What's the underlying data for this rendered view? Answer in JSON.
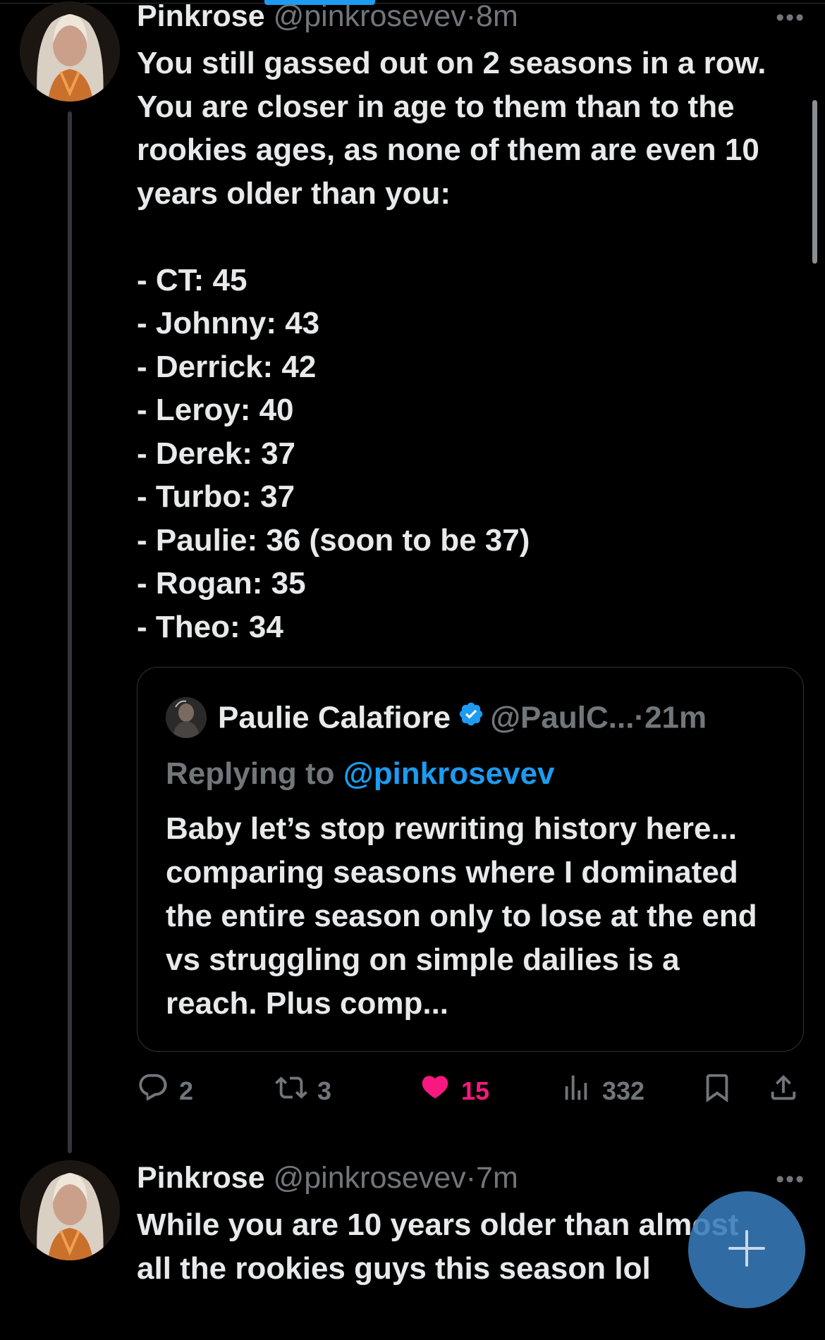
{
  "tweet1": {
    "display_name": "Pinkrose",
    "handle": "@pinkrosevev",
    "separator": "·",
    "time": "8m",
    "more": "•••",
    "paragraph": "You still gassed out on 2 seasons in a row. You are closer in age to them than to the rookies ages, as none of them are even 10 years older than you:",
    "list": [
      "- CT: 45",
      "- Johnny: 43",
      "- Derrick: 42",
      "- Leroy: 40",
      "- Derek: 37",
      "- Turbo: 37",
      "- Paulie: 36 (soon to be 37)",
      "- Rogan: 35",
      "- Theo: 34"
    ],
    "quote": {
      "display_name": "Paulie Calafiore",
      "handle": "@PaulC...",
      "separator": "·",
      "time": "21m",
      "replying_prefix": "Replying to",
      "replying_handle": "@pinkrosevev",
      "text": "Baby let’s stop rewriting history here... comparing seasons where I dominated the entire season only to lose at the end vs struggling on simple dailies is a reach. Plus comp..."
    },
    "actions": {
      "replies": "2",
      "reposts": "3",
      "likes": "15",
      "views": "332"
    }
  },
  "tweet2": {
    "display_name": "Pinkrose",
    "handle": "@pinkrosevev",
    "separator": "·",
    "time": "7m",
    "more": "•••",
    "text": "While you are 10 years older than almost all the rookies guys this season lol"
  },
  "colors": {
    "background": "#000000",
    "text": "#e7e9ea",
    "secondary": "#71767b",
    "link": "#1d9bf0",
    "like": "#f91880"
  },
  "icons": [
    "reply-icon",
    "repost-icon",
    "heart-icon",
    "views-icon",
    "bookmark-icon",
    "share-icon",
    "verified-icon",
    "compose-plus-icon"
  ]
}
